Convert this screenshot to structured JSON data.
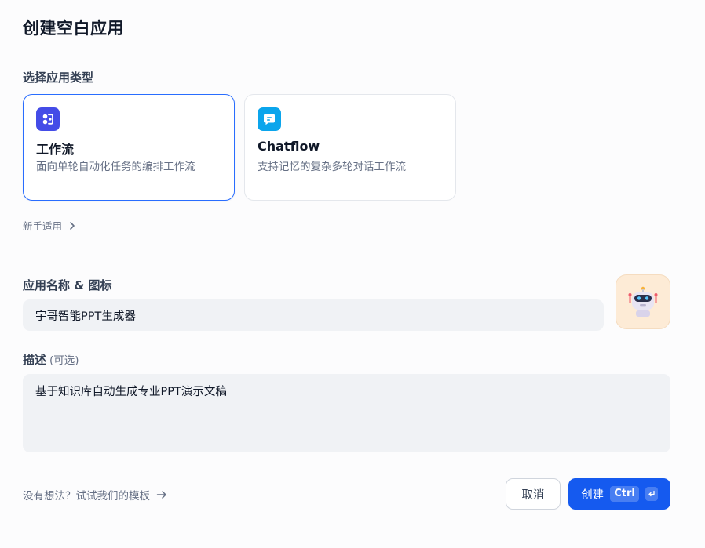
{
  "dialog": {
    "title": "创建空白应用"
  },
  "app_type": {
    "label": "选择应用类型",
    "cards": [
      {
        "name": "工作流",
        "desc": "面向单轮自动化任务的编排工作流",
        "icon": "workflow-icon",
        "icon_color": "#444ce7",
        "selected": true
      },
      {
        "name": "Chatflow",
        "desc": "支持记忆的复杂多轮对话工作流",
        "icon": "chatflow-icon",
        "icon_color": "#0ba5ec",
        "selected": false
      }
    ],
    "hint": "新手适用"
  },
  "name_icon": {
    "label": "应用名称 & 图标",
    "value": "宇哥智能PPT生成器",
    "avatar": "robot-icon",
    "avatar_bg": "#fdebd6"
  },
  "description": {
    "label": "描述",
    "optional": "(可选)",
    "value": "基于知识库自动生成专业PPT演示文稿"
  },
  "footer": {
    "template_link": "没有想法？试试我们的模板",
    "cancel": "取消",
    "create": "创建",
    "shortcut": "Ctrl"
  },
  "colors": {
    "accent": "#155aef",
    "selected_border": "#296dff"
  }
}
